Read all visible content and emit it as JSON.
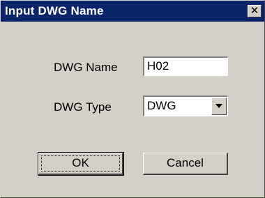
{
  "dialog": {
    "title": "Input DWG Name",
    "close_glyph": "✕",
    "close_icon": "close-icon"
  },
  "form": {
    "name_label": "DWG Name",
    "name_value": "H02",
    "type_label": "DWG Type",
    "type_value": "DWG",
    "type_dropdown_icon": "chevron-down-icon"
  },
  "buttons": {
    "ok_label": "OK",
    "cancel_label": "Cancel"
  },
  "colors": {
    "titlebar": "#0a246a",
    "face": "#d4d0c8"
  }
}
